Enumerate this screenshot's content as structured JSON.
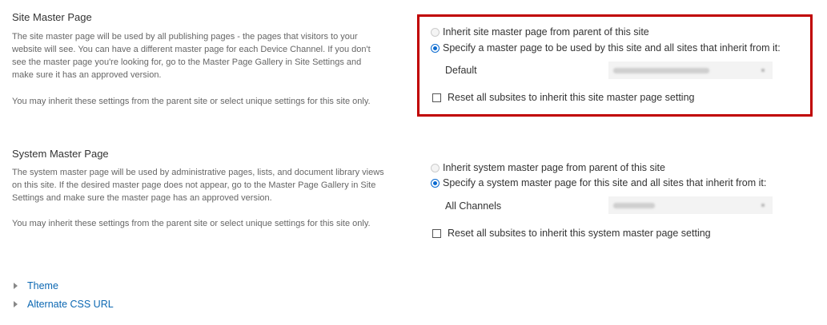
{
  "site_master": {
    "title": "Site Master Page",
    "description": "The site master page will be used by all publishing pages - the pages that visitors to your website will see. You can have a different master page for each Device Channel. If you don't see the master page you're looking for, go to the Master Page Gallery in Site Settings and make sure it has an approved version.",
    "inherit_note": "You may inherit these settings from the parent site or select unique settings for this site only.",
    "option_inherit": "Inherit site master page from parent of this site",
    "option_specify": "Specify a master page to be used by this site and all sites that inherit from it:",
    "channel_label": "Default",
    "reset_label": "Reset all subsites to inherit this site master page setting",
    "selected_option": "specify"
  },
  "system_master": {
    "title": "System Master Page",
    "description": "The system master page will be used by administrative pages, lists, and document library views on this site. If the desired master page does not appear, go to the Master Page Gallery in Site Settings and make sure the master page has an approved version.",
    "inherit_note": "You may inherit these settings from the parent site or select unique settings for this site only.",
    "option_inherit": "Inherit system master page from parent of this site",
    "option_specify": "Specify a system master page for this site and all sites that inherit from it:",
    "channel_label": "All Channels",
    "reset_label": "Reset all subsites to inherit this system master page setting",
    "selected_option": "specify"
  },
  "links": {
    "theme": "Theme",
    "alternate_css": "Alternate CSS URL"
  },
  "colors": {
    "highlight": "#c00000",
    "link": "#0b67b2",
    "radio_selected": "#0a6ad0"
  }
}
